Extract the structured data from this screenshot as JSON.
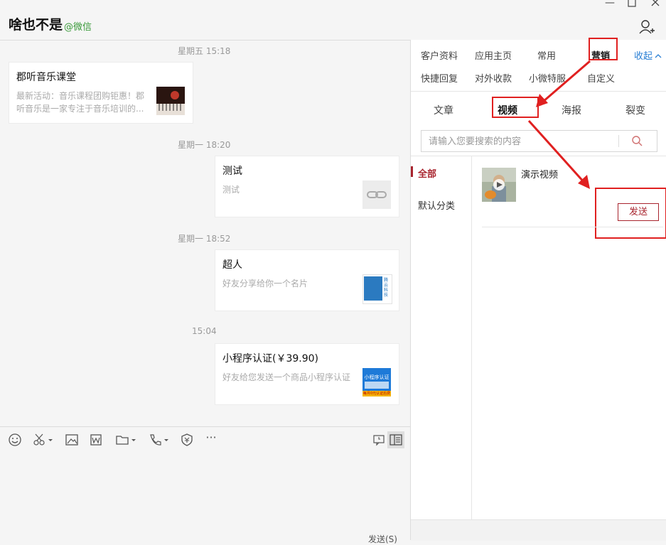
{
  "header": {
    "title": "啥也不是",
    "subtitle": "@微信"
  },
  "chat": {
    "messages": [
      {
        "time": "星期五 15:18",
        "title": "郡听音乐课堂",
        "desc": "最新活动：音乐课程团购钜惠！郡听音乐是一家专注于音乐培训的..."
      },
      {
        "time": "星期一 18:20",
        "title": "测试",
        "desc": "测试"
      },
      {
        "time": "星期一 18:52",
        "title": "超人",
        "desc": "好友分享给你一个名片",
        "logo_text": "腾云科技"
      },
      {
        "time": "15:04",
        "title": "小程序认证(￥39.90)",
        "desc": "好友给您发送一个商品小程序认证",
        "thumb_title": "小程序认证",
        "thumb_footer": "每月0元认证后费"
      }
    ]
  },
  "toolbar": {
    "send_label": "发送(S)"
  },
  "panel": {
    "tabs_row1": [
      "客户资料",
      "应用主页",
      "常用",
      "营销"
    ],
    "collapse_label": "收起",
    "tabs_row2": [
      "快捷回复",
      "对外收款",
      "小微特服",
      "自定义"
    ],
    "subtabs": [
      "文章",
      "视频",
      "海报",
      "裂变"
    ],
    "search_placeholder": "请输入您要搜索的内容",
    "categories": [
      "全部",
      "默认分类"
    ],
    "video": {
      "title": "演示视频",
      "send_label": "发送"
    }
  },
  "colors": {
    "accent_red": "#a8242e",
    "annotation_red": "#e02020",
    "wechat_green": "#3a9a3a",
    "link_blue": "#2a7fd4"
  }
}
